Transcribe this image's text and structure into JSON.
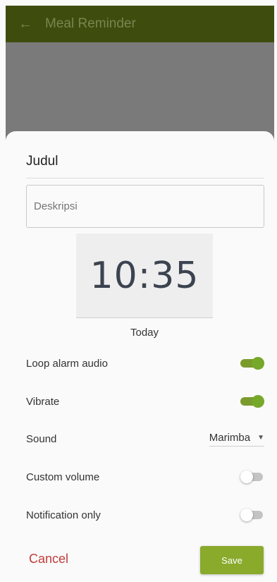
{
  "appbar": {
    "back_icon": "arrow-left-icon",
    "title": "Meal Reminder"
  },
  "form": {
    "title_label": "Judul",
    "description_placeholder": "Deskripsi",
    "time": "10:35",
    "day": "Today"
  },
  "settings": [
    {
      "label": "Loop alarm audio",
      "type": "toggle",
      "on": true
    },
    {
      "label": "Vibrate",
      "type": "toggle",
      "on": true
    },
    {
      "label": "Sound",
      "type": "select",
      "value": "Marimba"
    },
    {
      "label": "Custom volume",
      "type": "toggle",
      "on": false
    },
    {
      "label": "Notification only",
      "type": "toggle",
      "on": false
    }
  ],
  "actions": {
    "cancel_label": "Cancel",
    "save_label": "Save"
  },
  "colors": {
    "appbar": "#3e4d0e",
    "accent": "#8aaa2c",
    "cancel": "#c23b3b"
  }
}
